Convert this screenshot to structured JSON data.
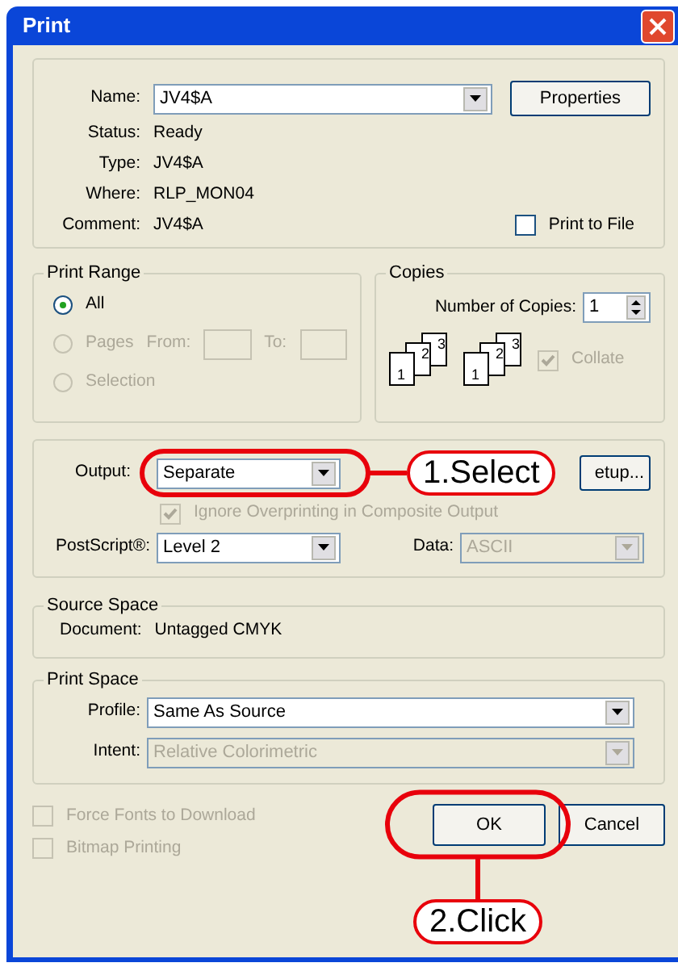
{
  "window": {
    "title": "Print"
  },
  "printer": {
    "fields": [
      {
        "label": "Name:",
        "value": "JV4$A",
        "kind": "dropdown"
      },
      {
        "label": "Status:",
        "value": "Ready",
        "kind": "text"
      },
      {
        "label": "Type:",
        "value": "JV4$A",
        "kind": "text"
      },
      {
        "label": "Where:",
        "value": "RLP_MON04",
        "kind": "text"
      },
      {
        "label": "Comment:",
        "value": "JV4$A",
        "kind": "text"
      }
    ],
    "properties_button": "Properties",
    "print_to_file": {
      "label": "Print to File",
      "checked": false
    }
  },
  "print_range": {
    "title": "Print Range",
    "options": [
      {
        "label": "All",
        "selected": true,
        "disabled": false
      },
      {
        "label": "Pages",
        "selected": false,
        "disabled": true
      },
      {
        "label": "Selection",
        "selected": false,
        "disabled": true
      }
    ],
    "from_label": "From:",
    "to_label": "To:"
  },
  "copies": {
    "title": "Copies",
    "label": "Number of Copies:",
    "value": "1",
    "collate_icons": [
      [
        "1",
        "2",
        "3"
      ],
      [
        "1",
        "2",
        "3"
      ]
    ],
    "collate": {
      "label": "Collate",
      "checked": true,
      "disabled": true
    }
  },
  "output": {
    "output_label": "Output:",
    "output_value": "Separate",
    "setup_button": "etup...",
    "ignore_overprinting": {
      "label": "Ignore Overprinting in Composite Output",
      "checked": true,
      "disabled": true
    },
    "postscript_label": "PostScript®:",
    "postscript_value": "Level 2",
    "data_label": "Data:",
    "data_value": "ASCII",
    "data_disabled": true
  },
  "source_space": {
    "title": "Source Space",
    "document_label": "Document:",
    "document_value": "Untagged CMYK"
  },
  "print_space": {
    "title": "Print Space",
    "profile_label": "Profile:",
    "profile_value": "Same As Source",
    "profile_disabled": false,
    "intent_label": "Intent:",
    "intent_value": "Relative Colorimetric",
    "intent_disabled": true
  },
  "options": [
    {
      "label": "Force Fonts to Download",
      "checked": false,
      "disabled": true
    },
    {
      "label": "Bitmap Printing",
      "checked": false,
      "disabled": true
    }
  ],
  "buttons": [
    {
      "label": "OK"
    },
    {
      "label": "Cancel"
    }
  ],
  "annotations": [
    {
      "label": "1.Select"
    },
    {
      "label": "2.Click"
    }
  ]
}
